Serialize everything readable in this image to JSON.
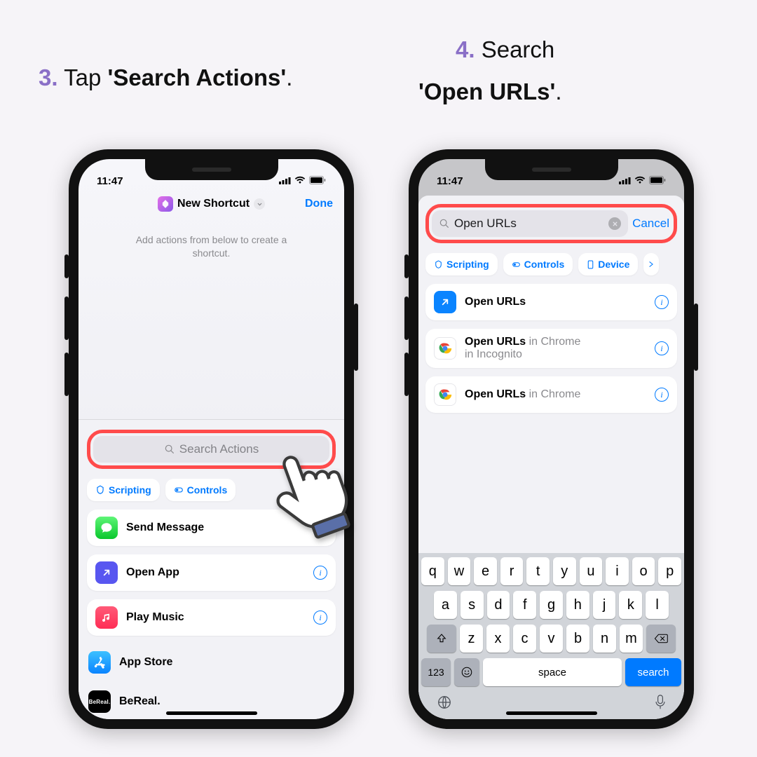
{
  "captions": {
    "step3": {
      "num": "3.",
      "pre": " Tap ",
      "bold": "'Search Actions'",
      "post": "."
    },
    "step4": {
      "num": "4.",
      "pre": " Search",
      "bold": "'Open URLs'",
      "post": "."
    }
  },
  "status_time": "11:47",
  "left": {
    "title": "New Shortcut",
    "done": "Done",
    "subtitle": "Add actions from below to create a shortcut.",
    "search_placeholder": "Search Actions",
    "chips": [
      "Scripting",
      "Controls"
    ],
    "rows": {
      "send_message": "Send Message",
      "open_app": "Open App",
      "play_music": "Play Music",
      "app_store": "App Store",
      "bereal": "BeReal."
    }
  },
  "right": {
    "search_value": "Open URLs",
    "cancel": "Cancel",
    "chips": [
      "Scripting",
      "Controls",
      "Device"
    ],
    "results": {
      "r1": {
        "title": "Open URLs"
      },
      "r2": {
        "title": "Open URLs",
        "suffix1": " in Chrome",
        "suffix2": "in Incognito"
      },
      "r3": {
        "title": "Open URLs",
        "suffix1": " in Chrome"
      }
    },
    "keyboard": {
      "row1": [
        "q",
        "w",
        "e",
        "r",
        "t",
        "y",
        "u",
        "i",
        "o",
        "p"
      ],
      "row2": [
        "a",
        "s",
        "d",
        "f",
        "g",
        "h",
        "j",
        "k",
        "l"
      ],
      "row3": [
        "z",
        "x",
        "c",
        "v",
        "b",
        "n",
        "m"
      ],
      "num": "123",
      "space": "space",
      "search": "search"
    }
  }
}
